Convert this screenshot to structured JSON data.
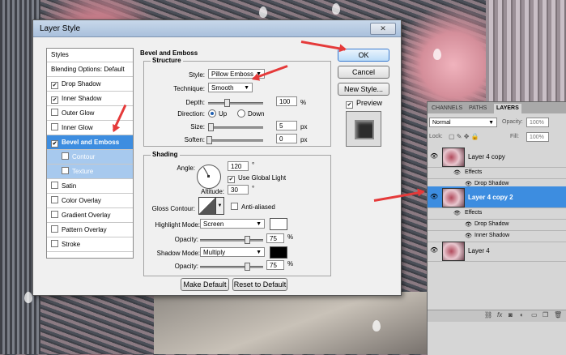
{
  "dialog": {
    "title": "Layer Style",
    "close_label": "✕",
    "styles_header": "Styles",
    "styles": [
      {
        "label": "Blending Options: Default",
        "checkbox": false,
        "checked": false,
        "state": "normal"
      },
      {
        "label": "Drop Shadow",
        "checkbox": true,
        "checked": true,
        "state": "normal"
      },
      {
        "label": "Inner Shadow",
        "checkbox": true,
        "checked": true,
        "state": "normal"
      },
      {
        "label": "Outer Glow",
        "checkbox": true,
        "checked": false,
        "state": "normal"
      },
      {
        "label": "Inner Glow",
        "checkbox": true,
        "checked": false,
        "state": "normal"
      },
      {
        "label": "Bevel and Emboss",
        "checkbox": true,
        "checked": true,
        "state": "selected"
      },
      {
        "label": "Contour",
        "checkbox": true,
        "checked": false,
        "state": "sub"
      },
      {
        "label": "Texture",
        "checkbox": true,
        "checked": false,
        "state": "sub"
      },
      {
        "label": "Satin",
        "checkbox": true,
        "checked": false,
        "state": "normal"
      },
      {
        "label": "Color Overlay",
        "checkbox": true,
        "checked": false,
        "state": "normal"
      },
      {
        "label": "Gradient Overlay",
        "checkbox": true,
        "checked": false,
        "state": "normal"
      },
      {
        "label": "Pattern Overlay",
        "checkbox": true,
        "checked": false,
        "state": "normal"
      },
      {
        "label": "Stroke",
        "checkbox": true,
        "checked": false,
        "state": "normal"
      }
    ],
    "section_title": "Bevel and Emboss",
    "structure": {
      "group_label": "Structure",
      "style_label": "Style:",
      "style_value": "Pillow Emboss",
      "technique_label": "Technique:",
      "technique_value": "Smooth",
      "depth_label": "Depth:",
      "depth_value": "100",
      "depth_unit": "%",
      "direction_label": "Direction:",
      "direction_up": "Up",
      "direction_down": "Down",
      "direction_selected": "Up",
      "size_label": "Size:",
      "size_value": "5",
      "size_unit": "px",
      "soften_label": "Soften:",
      "soften_value": "0",
      "soften_unit": "px"
    },
    "shading": {
      "group_label": "Shading",
      "angle_label": "Angle:",
      "angle_value": "120",
      "angle_unit": "°",
      "global_light_label": "Use Global Light",
      "global_light_checked": true,
      "altitude_label": "Altitude:",
      "altitude_value": "30",
      "altitude_unit": "°",
      "gloss_label": "Gloss Contour:",
      "anti_aliased_label": "Anti-aliased",
      "anti_aliased_checked": false,
      "highlight_mode_label": "Highlight Mode:",
      "highlight_mode_value": "Screen",
      "highlight_color": "#ffffff",
      "highlight_opacity_label": "Opacity:",
      "highlight_opacity_value": "75",
      "highlight_opacity_unit": "%",
      "shadow_mode_label": "Shadow Mode:",
      "shadow_mode_value": "Multiply",
      "shadow_color": "#000000",
      "shadow_opacity_label": "Opacity:",
      "shadow_opacity_value": "75",
      "shadow_opacity_unit": "%"
    },
    "make_default_label": "Make Default",
    "reset_default_label": "Reset to Default",
    "ok_label": "OK",
    "cancel_label": "Cancel",
    "new_style_label": "New Style...",
    "preview_label": "Preview",
    "preview_checked": true
  },
  "layers_panel": {
    "tabs": [
      "CHANNELS",
      "PATHS",
      "LAYERS"
    ],
    "active_tab": "LAYERS",
    "blend_mode": "Normal",
    "opacity_label": "Opacity:",
    "opacity_value": "100%",
    "lock_label": "Lock:",
    "fill_label": "Fill:",
    "fill_value": "100%",
    "layers": [
      {
        "name": "Layer 4 copy",
        "effects_label": "Effects",
        "effects": [
          "Drop Shadow"
        ],
        "selected": false
      },
      {
        "name": "Layer 4 copy 2",
        "effects_label": "Effects",
        "effects": [
          "Drop Shadow",
          "Inner Shadow"
        ],
        "selected": true
      },
      {
        "name": "Layer 4",
        "effects_label": "",
        "effects": [],
        "selected": false
      }
    ],
    "footer_icons": [
      "link-icon",
      "fx-icon",
      "mask-icon",
      "adjustment-icon",
      "folder-icon",
      "new-layer-icon",
      "trash-icon"
    ],
    "accent_color": "#3d8de0"
  }
}
